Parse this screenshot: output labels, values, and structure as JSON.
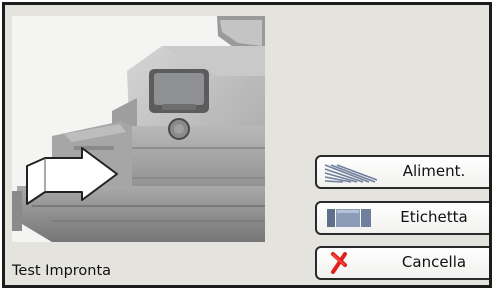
{
  "screen": {
    "caption": "Test Impronta"
  },
  "buttons": [
    {
      "id": "feed",
      "label": "Aliment.",
      "icon": "feed-lines-icon"
    },
    {
      "id": "label",
      "label": "Etichetta",
      "icon": "label-roll-icon"
    },
    {
      "id": "cancel",
      "label": "Cancella",
      "icon": "red-x-icon"
    }
  ],
  "colors": {
    "frame": "#1c1c1c",
    "background": "#e4e3de",
    "icon_blue": "#6f7f9c",
    "cancel_red": "#e0201c"
  }
}
